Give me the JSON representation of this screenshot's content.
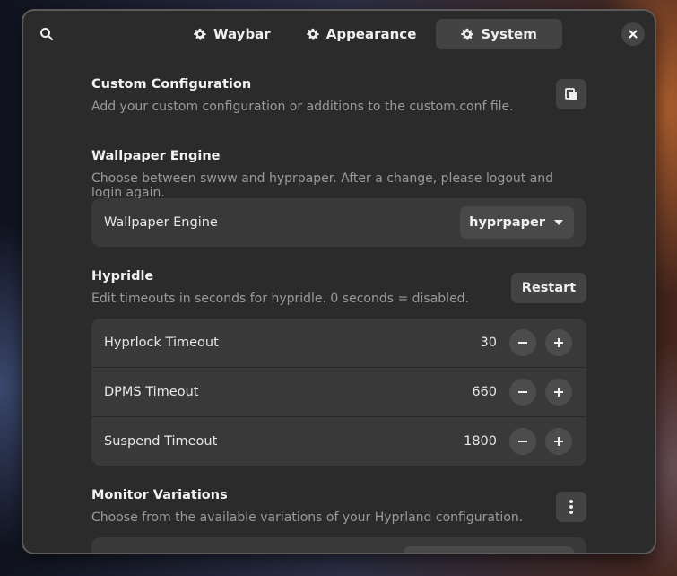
{
  "header": {
    "tabs": [
      {
        "label": "Waybar",
        "icon": "gear-icon",
        "active": false
      },
      {
        "label": "Appearance",
        "icon": "gear-icon",
        "active": false
      },
      {
        "label": "System",
        "icon": "gear-icon",
        "active": true
      }
    ]
  },
  "custom_config": {
    "title": "Custom Configuration",
    "description": "Add your custom configuration or additions to the custom.conf file.",
    "action_icon": "edit-file-icon"
  },
  "wallpaper": {
    "title": "Wallpaper Engine",
    "description": "Choose between swww and hyprpaper. After a change, please logout and login again.",
    "row_label": "Wallpaper Engine",
    "selected": "hyprpaper"
  },
  "hypridle": {
    "title": "Hypridle",
    "description": "Edit timeouts in seconds for hypridle. 0 seconds = disabled.",
    "restart_label": "Restart",
    "rows": [
      {
        "label": "Hyprlock Timeout",
        "value": "30"
      },
      {
        "label": "DPMS Timeout",
        "value": "660"
      },
      {
        "label": "Suspend Timeout",
        "value": "1800"
      }
    ]
  },
  "monitor": {
    "title": "Monitor Variations",
    "description": "Choose from the available variations of your Hyprland configuration.",
    "menu_icon": "vertical-dots-icon"
  },
  "colors": {
    "window_bg": "#2c2b2b",
    "card_bg": "#3a3939",
    "button_bg": "#444343"
  }
}
